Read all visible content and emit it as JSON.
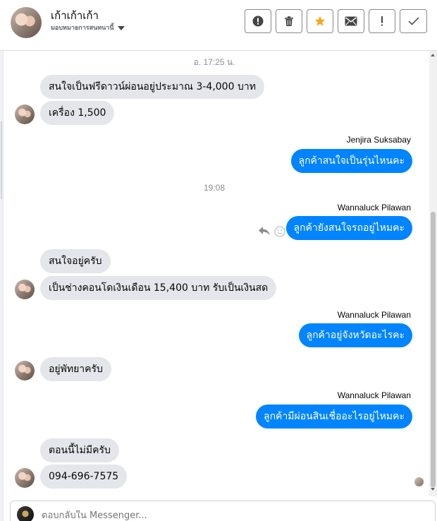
{
  "header": {
    "name": "เก้าเก้าเก้า",
    "assignee_text": "มอบหมายการสนทนานี้"
  },
  "toolbar": {
    "icons": [
      "alert-circle-icon",
      "trash-icon",
      "star-icon",
      "envelope-icon",
      "exclamation-icon",
      "check-icon"
    ],
    "star_color": "#f5a623"
  },
  "conversation": {
    "timestamps": [
      "อ. 17:25 น.",
      "19:08"
    ],
    "messages": [
      {
        "direction": "in",
        "text": "สนใจเป็นฟรีดาวน์ผ่อนอยู่ประมาณ 3-4,000 บาท"
      },
      {
        "direction": "in",
        "text": "เครื่อง 1,500"
      },
      {
        "direction": "out",
        "sender": "Jenjira Suksabay",
        "text": "ลูกค้าสนใจเป็นรุ่นไหนคะ"
      },
      {
        "direction": "out",
        "sender": "Wannaluck Pilawan",
        "text": "ลูกค้ายังสนใจรถอยู่ไหมคะ"
      },
      {
        "direction": "in",
        "text": "สนใจอยู่ครับ"
      },
      {
        "direction": "in",
        "text": "เป็นช่างคอนโดเงินเดือน 15,400 บาท รับเป็นเงินสด"
      },
      {
        "direction": "out",
        "sender": "Wannaluck Pilawan",
        "text": "ลูกค้าอยู่จังหวัดอะไรคะ"
      },
      {
        "direction": "in",
        "text": "อยู่พัทยาครับ"
      },
      {
        "direction": "out",
        "sender": "Wannaluck Pilawan",
        "text": "ลูกค้ามีผ่อนสินเชื่ออะไรอยู่ไหมคะ"
      },
      {
        "direction": "in",
        "text": "ตอนนี้ไม่มีครับ"
      },
      {
        "direction": "in",
        "text": "094-696-7575"
      }
    ]
  },
  "composer": {
    "placeholder": "ตอบกลับใน Messenger..."
  },
  "colors": {
    "outgoing_bubble": "#0084ff",
    "incoming_bubble": "#e4e6eb"
  }
}
